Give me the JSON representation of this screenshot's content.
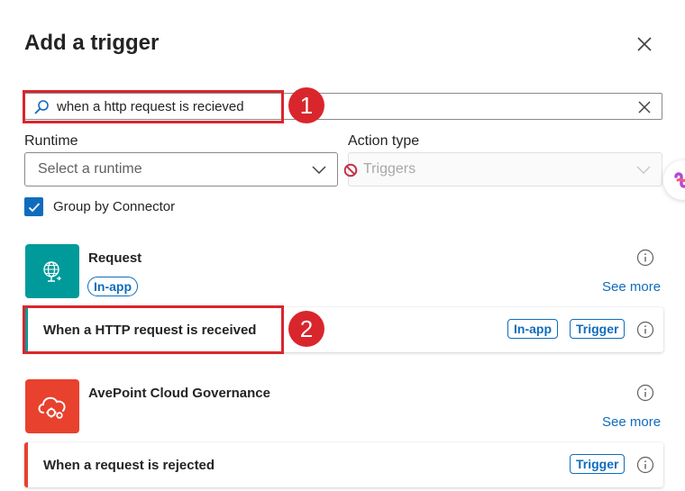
{
  "panel": {
    "title": "Add a trigger",
    "close_icon": "close-icon"
  },
  "search": {
    "value": "when a http request is recieved",
    "icon": "search-icon",
    "clear_icon": "dismiss-icon"
  },
  "filters": {
    "runtime": {
      "label": "Runtime",
      "placeholder": "Select a runtime"
    },
    "action_type": {
      "label": "Action type",
      "placeholder": "Triggers",
      "disabled": true
    }
  },
  "group_by": {
    "label": "Group by Connector",
    "checked": true
  },
  "callouts": [
    "1",
    "2"
  ],
  "connectors": [
    {
      "name": "Request",
      "badge": "In-app",
      "see_more": "See more",
      "icon": "globe-request-icon",
      "color": "#009a9a",
      "actions": [
        {
          "name": "When a HTTP request is received",
          "tags": [
            "In-app",
            "Trigger"
          ],
          "accent": "#009a9a"
        }
      ]
    },
    {
      "name": "AvePoint Cloud Governance",
      "see_more": "See more",
      "icon": "cloud-gears-icon",
      "color": "#e8412e",
      "actions": [
        {
          "name": "When a request is rejected",
          "tags": [
            "Trigger"
          ],
          "accent": "#e8412e"
        }
      ]
    }
  ],
  "colors": {
    "brand": "#0f6cbd",
    "callout": "#d9262c"
  }
}
